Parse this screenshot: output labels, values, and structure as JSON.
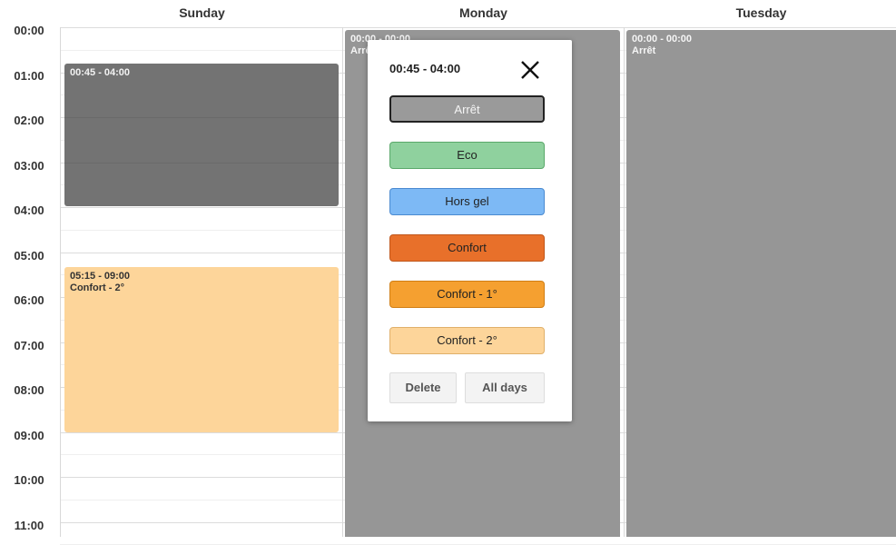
{
  "days": [
    "Sunday",
    "Monday",
    "Tuesday"
  ],
  "hours": [
    "00:00",
    "01:00",
    "02:00",
    "03:00",
    "04:00",
    "05:00",
    "06:00",
    "07:00",
    "08:00",
    "09:00",
    "10:00",
    "11:00"
  ],
  "events": {
    "sunday_1": {
      "time": "00:45 - 04:00",
      "mode": ""
    },
    "sunday_2": {
      "time": "05:15 - 09:00",
      "mode": "Confort - 2°"
    },
    "monday_1": {
      "time": "00:00 - 00:00",
      "mode": "Arrêt"
    },
    "tuesday_1": {
      "time": "00:00 - 00:00",
      "mode": "Arrêt"
    }
  },
  "popup": {
    "title": "00:45 - 04:00",
    "close_icon": "close-icon",
    "modes": [
      {
        "label": "Arrêt",
        "bg": "#9a9a9a",
        "border": "#222222",
        "color": "#f5f5f5"
      },
      {
        "label": "Eco",
        "bg": "#8fd19e",
        "border": "#5aa86a",
        "color": "#222222"
      },
      {
        "label": "Hors gel",
        "bg": "#7db9f5",
        "border": "#4a8ad0",
        "color": "#222222"
      },
      {
        "label": "Confort",
        "bg": "#e8702a",
        "border": "#c0561a",
        "color": "#222222"
      },
      {
        "label": "Confort - 1°",
        "bg": "#f5a030",
        "border": "#d07e14",
        "color": "#222222"
      },
      {
        "label": "Confort - 2°",
        "bg": "#fdd59a",
        "border": "#e0b06a",
        "color": "#222222"
      }
    ],
    "delete_label": "Delete",
    "all_days_label": "All days"
  }
}
